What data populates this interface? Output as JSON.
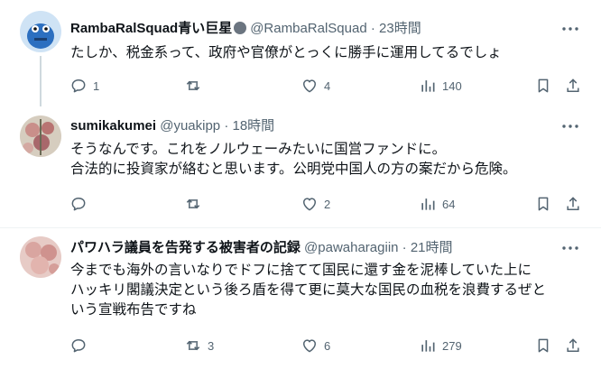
{
  "tweets": [
    {
      "name": "RambaRalSquad青い巨星",
      "handle": "@RambaRalSquad",
      "time": "23時間",
      "lines": [
        "たしか、税金系って、政府や官僚がとっくに勝手に運用してるでしょ"
      ],
      "reply_count": "1",
      "retweet_count": "",
      "like_count": "4",
      "view_count": "140"
    },
    {
      "name": "sumikakumei",
      "handle": "@yuakipp",
      "time": "18時間",
      "lines": [
        "そうなんです。これをノルウェーみたいに国営ファンドに。",
        "合法的に投資家が絡むと思います。公明党中国人の方の案だから危険。"
      ],
      "reply_count": "",
      "retweet_count": "",
      "like_count": "2",
      "view_count": "64"
    },
    {
      "name": "パワハラ議員を告発する被害者の記録",
      "handle": "@pawaharagiin",
      "time": "21時間",
      "lines": [
        "今までも海外の言いなりでドフに捨てて国民に還す金を泥棒していた上に",
        "ハッキリ閣議決定という後ろ盾を得て更に莫大な国民の血税を浪費するぜと",
        "いう宣戦布告ですね"
      ],
      "reply_count": "",
      "retweet_count": "3",
      "like_count": "6",
      "view_count": "279"
    }
  ],
  "separator": " · ",
  "colors": {
    "text": "#0f1419",
    "secondary": "#536471",
    "border": "#eff3f4",
    "thread_line": "#cfd9de"
  }
}
